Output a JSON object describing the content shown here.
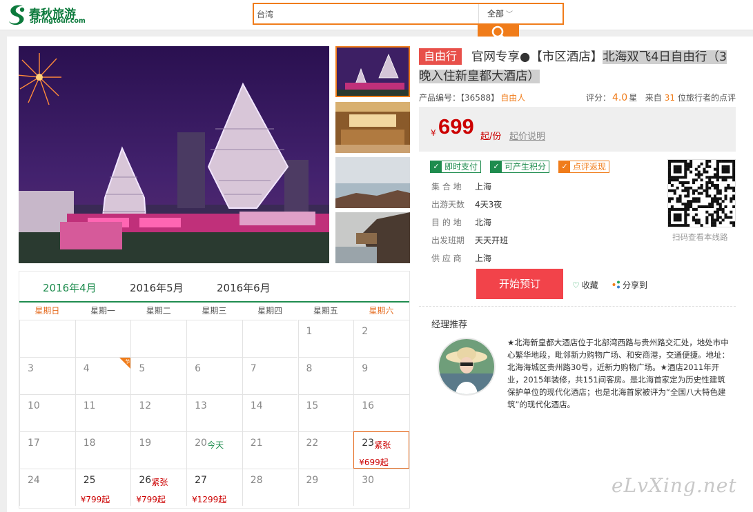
{
  "header": {
    "logo": {
      "name_cn": "春秋旅游",
      "name_en": "springtour.com"
    },
    "search": {
      "value": "台湾",
      "category": "全部",
      "icon": "search-icon"
    }
  },
  "product": {
    "badge": "自由行",
    "title_plain": "官网专享●【市区酒店】",
    "title_highlight": "北海双飞4日自由行（3晚入住新皇都大酒店）",
    "code_label": "产品编号：【36588】",
    "code_tag": "自由人",
    "rating": {
      "label": "评分：",
      "score": "4.0",
      "unit": "星",
      "from_label": "来自",
      "count": "31",
      "count_suffix": "位旅行者的点评"
    },
    "price": {
      "currency": "¥",
      "amount": "699",
      "unit": "起/份",
      "explain": "起价说明"
    },
    "features": [
      {
        "label": "即时支付",
        "color": "#1e8c4e"
      },
      {
        "label": "可产生积分",
        "color": "#1e8c4e"
      },
      {
        "label": "点评返现",
        "color": "#f07c1a"
      }
    ],
    "info": [
      {
        "label": "集 合 地",
        "value": "上海"
      },
      {
        "label": "出游天数",
        "value": "4天3夜"
      },
      {
        "label": "目 的 地",
        "value": "北海"
      },
      {
        "label": "出发班期",
        "value": "天天开班"
      },
      {
        "label": "供 应 商",
        "value": "上海"
      }
    ],
    "qr_caption": "扫码查看本线路",
    "actions": {
      "book": "开始预订",
      "favorite": "收藏",
      "share": "分享到"
    }
  },
  "manager": {
    "title": "经理推荐",
    "text": "★北海新皇都大酒店位于北部湾西路与贵州路交汇处，地处市中心繁华地段，毗邻新力购物广场、和安商港，交通便捷。地址：北海海城区贵州路30号，近新力购物广场。★酒店2011年开业，2015年装修，共151间客房。是北海首家定为历史性建筑保护单位的现代化酒店；也是北海首家被评为“全国八大特色建筑”的现代化酒店。"
  },
  "calendar": {
    "tabs": [
      "2016年4月",
      "2016年5月",
      "2016年6月"
    ],
    "active_tab": 0,
    "weekdays": [
      "星期日",
      "星期一",
      "星期二",
      "星期三",
      "星期四",
      "星期五",
      "星期六"
    ],
    "weeks": [
      [
        null,
        null,
        null,
        null,
        null,
        {
          "day": "1"
        },
        {
          "day": "2"
        }
      ],
      [
        {
          "day": "3"
        },
        {
          "day": "4",
          "corner": "节"
        },
        {
          "day": "5"
        },
        {
          "day": "6"
        },
        {
          "day": "7"
        },
        {
          "day": "8"
        },
        {
          "day": "9"
        }
      ],
      [
        {
          "day": "10"
        },
        {
          "day": "11"
        },
        {
          "day": "12"
        },
        {
          "day": "13"
        },
        {
          "day": "14"
        },
        {
          "day": "15"
        },
        {
          "day": "16"
        }
      ],
      [
        {
          "day": "17"
        },
        {
          "day": "18"
        },
        {
          "day": "19"
        },
        {
          "day": "20",
          "label": "今天",
          "today": true
        },
        {
          "day": "21"
        },
        {
          "day": "22"
        },
        {
          "day": "23",
          "label": "紧张",
          "price": "¥699起",
          "selected": true
        }
      ],
      [
        {
          "day": "24"
        },
        {
          "day": "25",
          "price": "¥799起"
        },
        {
          "day": "26",
          "label": "紧张",
          "price": "¥799起"
        },
        {
          "day": "27",
          "price": "¥1299起"
        },
        {
          "day": "28"
        },
        {
          "day": "29"
        },
        {
          "day": "30"
        }
      ]
    ]
  },
  "watermark": "eLvXing.net"
}
